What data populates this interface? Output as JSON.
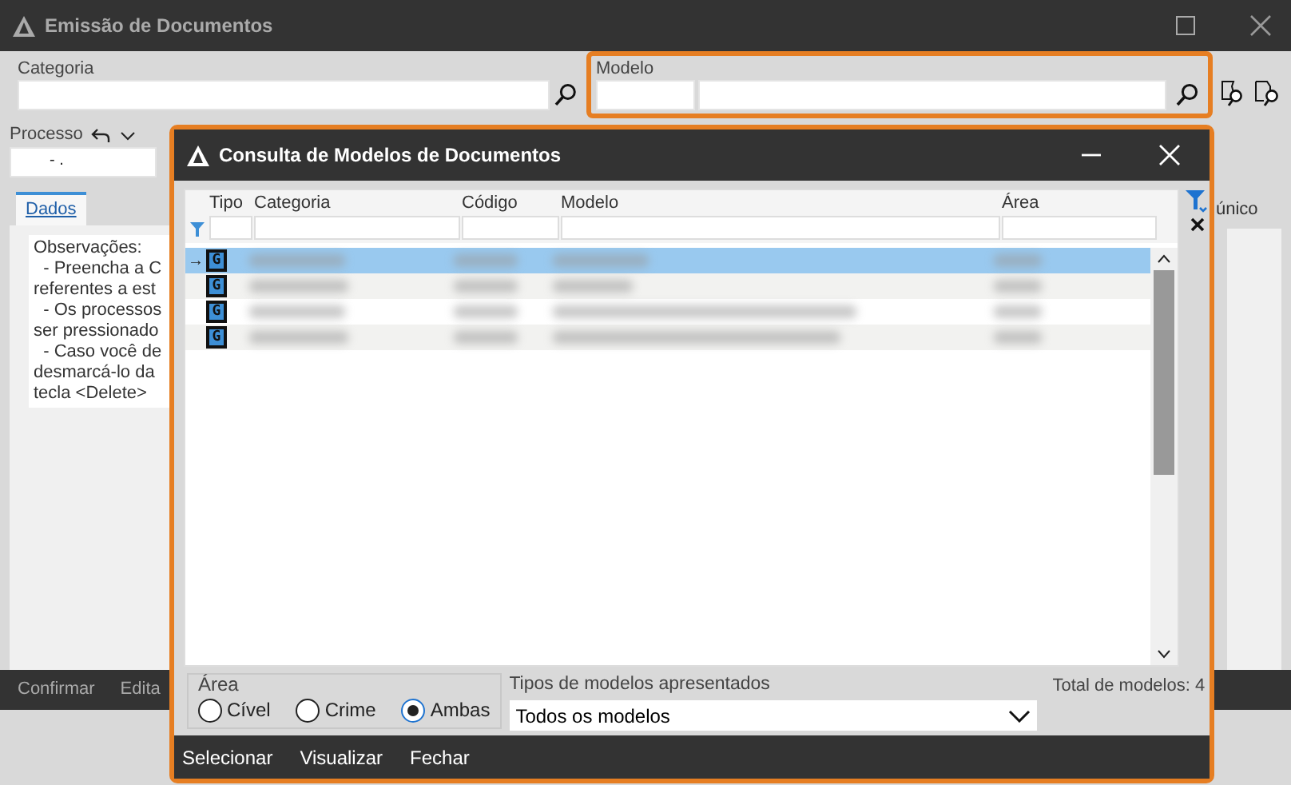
{
  "window": {
    "title": "Emissão de Documentos"
  },
  "categoria": {
    "label": "Categoria"
  },
  "modelo": {
    "label": "Modelo",
    "highlighted": true
  },
  "processo": {
    "label": "Processo",
    "value": "- ."
  },
  "tabs": [
    {
      "label": "Dados",
      "selected": true
    }
  ],
  "observations": [
    "Observações:",
    "  - Preencha a C",
    "referentes a est",
    "  - Os processos",
    "ser pressionado",
    "  - Caso você de",
    "desmarcá-lo da",
    "tecla <Delete>"
  ],
  "side_label": "único",
  "footer_buttons": [
    "Confirmar",
    "Edita"
  ],
  "dialog": {
    "title": "Consulta de Modelos de Documentos",
    "highlighted": true,
    "columns": [
      "Tipo",
      "Categoria",
      "Código",
      "Modelo",
      "Área"
    ],
    "rows": [
      {
        "type_icon": "G",
        "selected": true,
        "pointer": "→"
      },
      {
        "type_icon": "G",
        "selected": false
      },
      {
        "type_icon": "G",
        "selected": false
      },
      {
        "type_icon": "G",
        "selected": false
      }
    ],
    "area": {
      "label": "Área",
      "options": [
        {
          "label": "Cível",
          "selected": false
        },
        {
          "label": "Crime",
          "selected": false
        },
        {
          "label": "Ambas",
          "selected": true
        }
      ]
    },
    "types": {
      "label": "Tipos de modelos apresentados",
      "value": "Todos os modelos"
    },
    "total": "Total de modelos: 4",
    "buttons": [
      "Selecionar",
      "Visualizar",
      "Fechar"
    ]
  }
}
